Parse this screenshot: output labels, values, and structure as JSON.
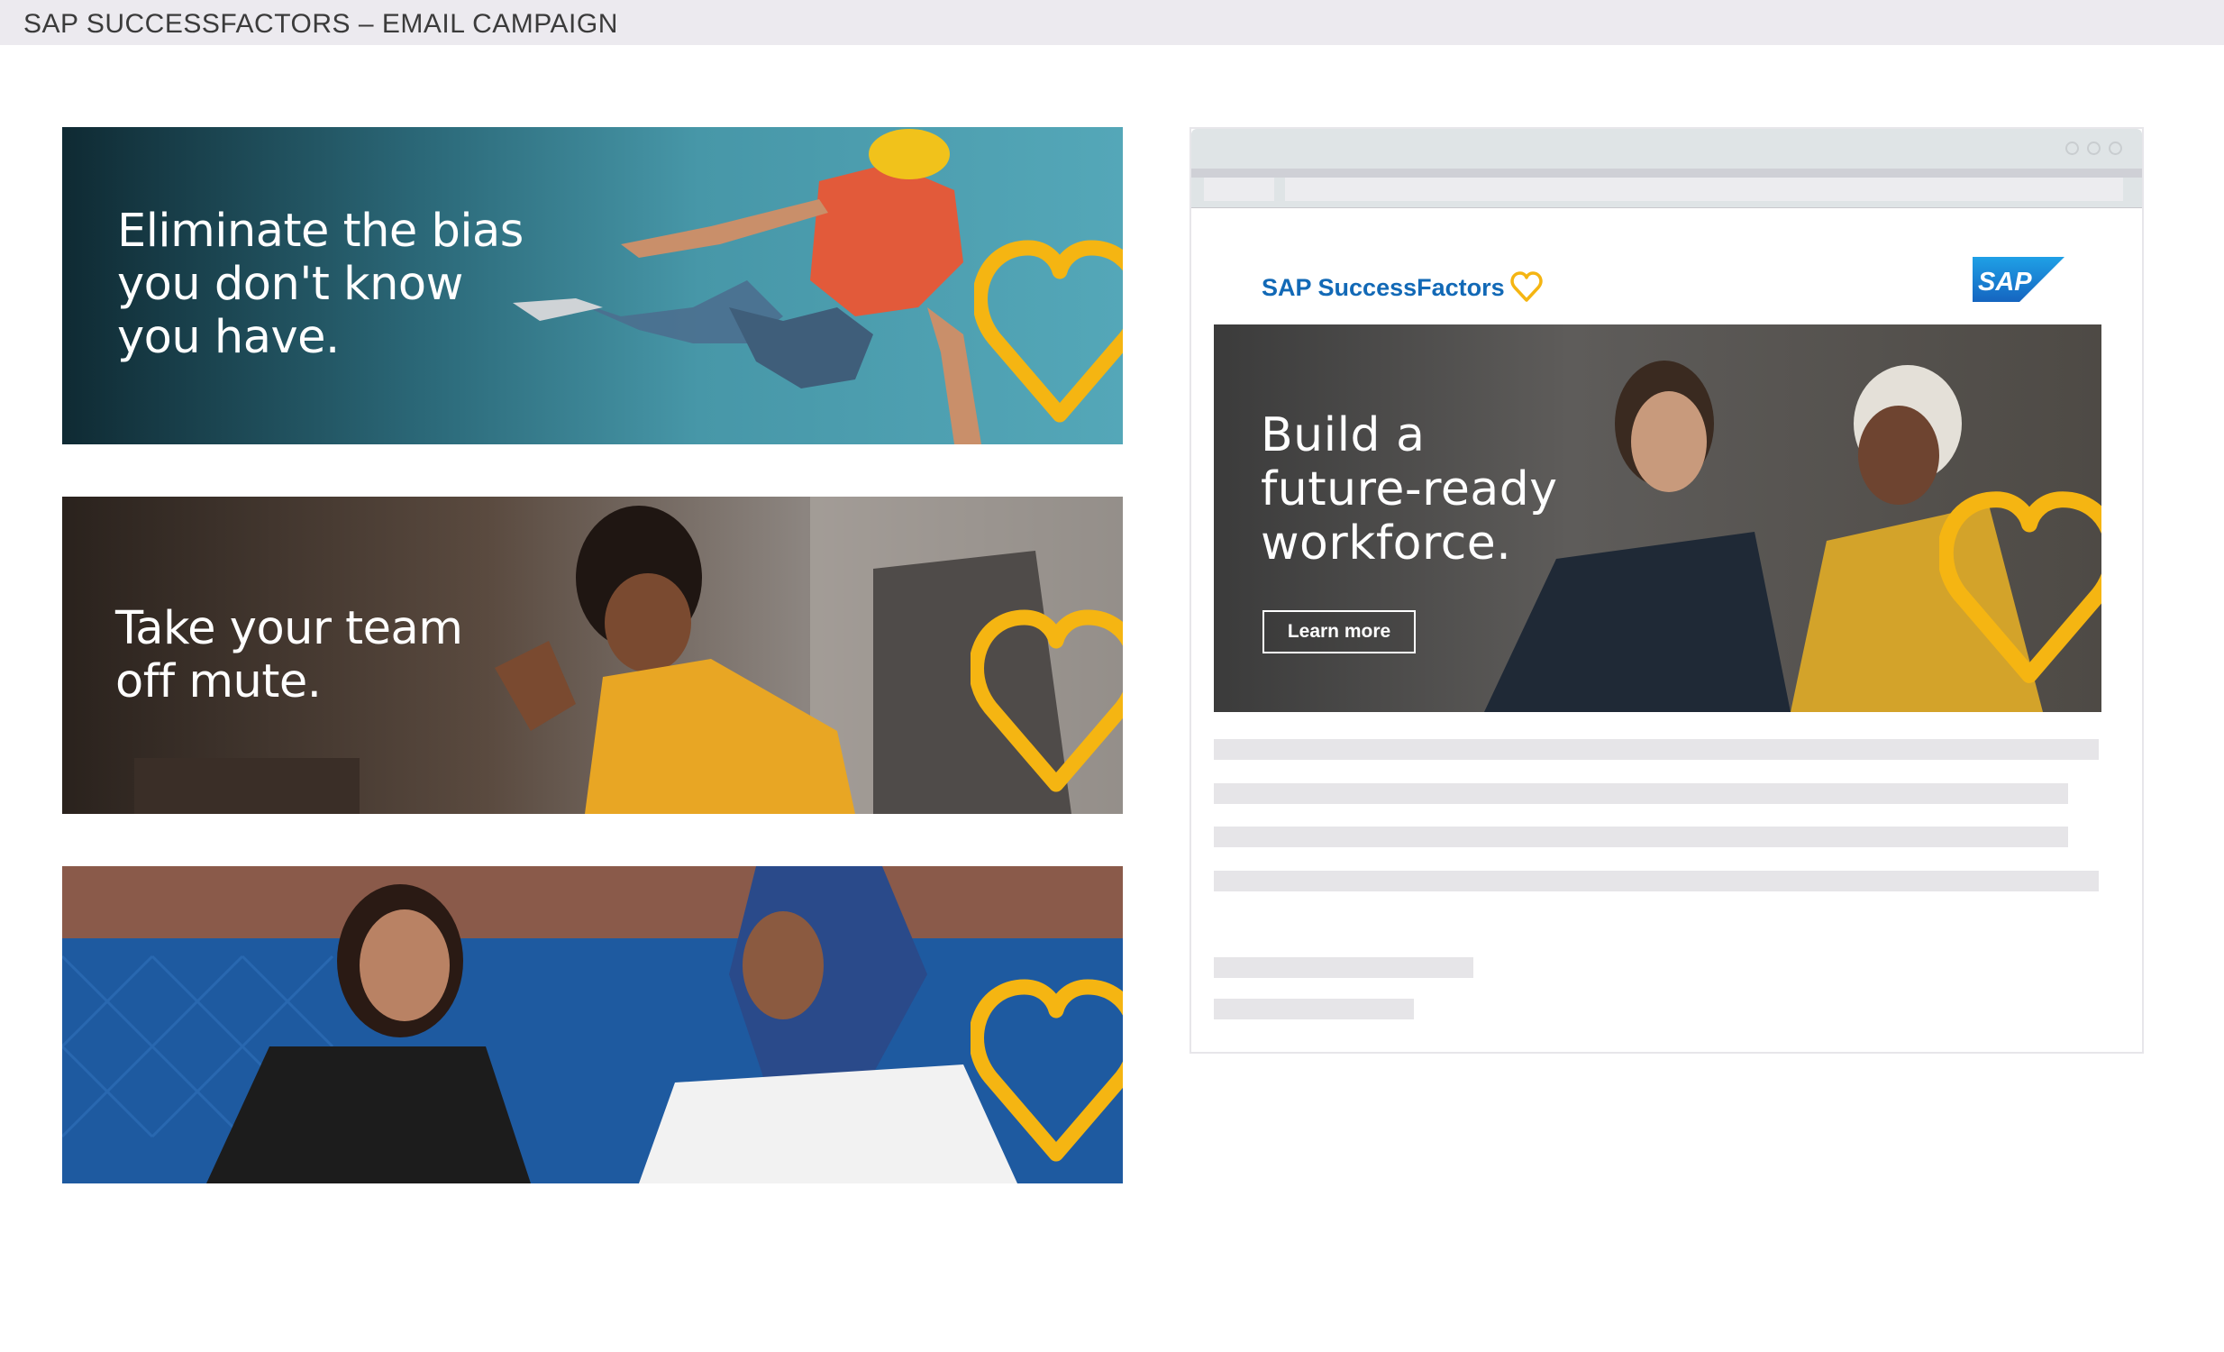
{
  "header": {
    "title": "SAP SUCCESSFACTORS – EMAIL CAMPAIGN"
  },
  "banners": [
    {
      "headline_lines": [
        "Eliminate the bias",
        "you don't know",
        "you have."
      ]
    },
    {
      "headline_lines": [
        "Take your team",
        "off mute."
      ]
    },
    {
      "headline_lines": []
    }
  ],
  "email_preview": {
    "brand": {
      "name": "SAP SuccessFactors",
      "sap_logo_text": "SAP"
    },
    "hero": {
      "headline_lines": [
        "Build a",
        "future-ready",
        "workforce."
      ],
      "cta_label": "Learn more"
    }
  },
  "colors": {
    "accent_yellow": "#f5b512",
    "brand_blue": "#1269b6",
    "topbar_bg": "#eceaef",
    "skeleton": "#e6e5e8"
  },
  "icons": [
    "heart-icon",
    "sap-logo",
    "window-dots"
  ]
}
